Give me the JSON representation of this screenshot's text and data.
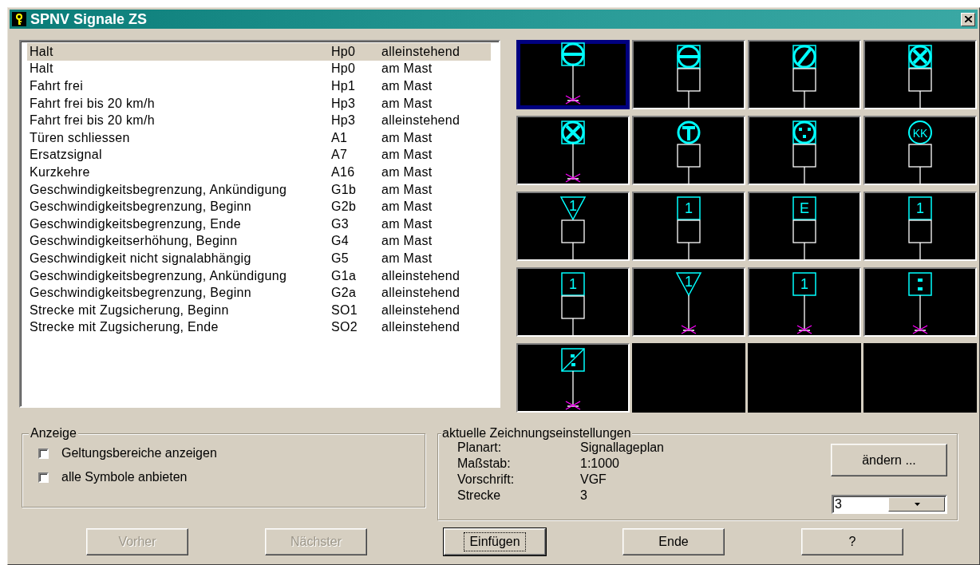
{
  "window": {
    "title": "SPNV Signale ZS"
  },
  "signals": [
    {
      "name": "Halt",
      "code": "Hp0",
      "placement": "alleinstehend",
      "selected": true
    },
    {
      "name": "Halt",
      "code": "Hp0",
      "placement": "am Mast",
      "selected": false
    },
    {
      "name": "Fahrt frei",
      "code": "Hp1",
      "placement": "am Mast",
      "selected": false
    },
    {
      "name": "Fahrt frei bis 20 km/h",
      "code": "Hp3",
      "placement": "am Mast",
      "selected": false
    },
    {
      "name": "Fahrt frei bis 20 km/h",
      "code": "Hp3",
      "placement": "alleinstehend",
      "selected": false
    },
    {
      "name": "Türen schliessen",
      "code": "A1",
      "placement": "am Mast",
      "selected": false
    },
    {
      "name": "Ersatzsignal",
      "code": "A7",
      "placement": "am Mast",
      "selected": false
    },
    {
      "name": "Kurzkehre",
      "code": "A16",
      "placement": "am Mast",
      "selected": false
    },
    {
      "name": "Geschwindigkeitsbegrenzung, Ankündigung",
      "code": "G1b",
      "placement": "am Mast",
      "selected": false
    },
    {
      "name": "Geschwindigkeitsbegrenzung, Beginn",
      "code": "G2b",
      "placement": "am Mast",
      "selected": false
    },
    {
      "name": "Geschwindigkeitsbegrenzung, Ende",
      "code": "G3",
      "placement": "am Mast",
      "selected": false
    },
    {
      "name": "Geschwindigkeitserhöhung, Beginn",
      "code": "G4",
      "placement": "am Mast",
      "selected": false
    },
    {
      "name": "Geschwindigkeit nicht signalabhängig",
      "code": "G5",
      "placement": "am Mast",
      "selected": false
    },
    {
      "name": "Geschwindigkeitsbegrenzung, Ankündigung",
      "code": "G1a",
      "placement": "alleinstehend",
      "selected": false
    },
    {
      "name": "Geschwindigkeitsbegrenzung, Beginn",
      "code": "G2a",
      "placement": "alleinstehend",
      "selected": false
    },
    {
      "name": "Strecke mit Zugsicherung, Beginn",
      "code": "SO1",
      "placement": "alleinstehend",
      "selected": false
    },
    {
      "name": "Strecke mit Zugsicherung, Ende",
      "code": "SO2",
      "placement": "alleinstehend",
      "selected": false
    }
  ],
  "tiles": [
    {
      "kind": "circlebar",
      "mast": false,
      "selected": true
    },
    {
      "kind": "circlebar",
      "mast": true,
      "selected": false
    },
    {
      "kind": "circleslash",
      "mast": true,
      "selected": false
    },
    {
      "kind": "circlecross",
      "mast": true,
      "selected": false
    },
    {
      "kind": "circlecross",
      "mast": false,
      "selected": false
    },
    {
      "kind": "circlet",
      "mast": true,
      "selected": false
    },
    {
      "kind": "circledots",
      "mast": true,
      "selected": false
    },
    {
      "kind": "circleletters",
      "label": "KK",
      "mast": true,
      "selected": false
    },
    {
      "kind": "triangle",
      "label": "1",
      "mast": true,
      "selected": false
    },
    {
      "kind": "box",
      "label": "1",
      "mast": true,
      "selected": false
    },
    {
      "kind": "box",
      "label": "E",
      "mast": true,
      "selected": false
    },
    {
      "kind": "box",
      "label": "1",
      "mast": true,
      "selected": false
    },
    {
      "kind": "box",
      "label": "1",
      "mast": true,
      "selected": false
    },
    {
      "kind": "triangle",
      "label": "1",
      "mast": false,
      "selected": false
    },
    {
      "kind": "box",
      "label": "1",
      "mast": false,
      "selected": false
    },
    {
      "kind": "boxdots",
      "mast": false,
      "selected": false
    },
    {
      "kind": "boxslashdots",
      "mast": false,
      "selected": false
    },
    {
      "kind": "empty"
    },
    {
      "kind": "empty"
    },
    {
      "kind": "empty"
    }
  ],
  "display_group": {
    "title": "Anzeige",
    "options": [
      {
        "label": "Geltungsbereiche anzeigen",
        "checked": false
      },
      {
        "label": "alle Symbole anbieten",
        "checked": false
      }
    ]
  },
  "settings_group": {
    "title": "aktuelle Zeichnungseinstellungen",
    "rows": [
      {
        "label": "Planart:",
        "value": "Signallageplan"
      },
      {
        "label": "Maßstab:",
        "value": "1:1000"
      },
      {
        "label": "Vorschrift:",
        "value": "VGF"
      },
      {
        "label": "Strecke",
        "value": "3"
      }
    ],
    "change_button": "ändern ...",
    "track_combo": {
      "value": "3"
    }
  },
  "buttons": [
    {
      "label": "Vorher",
      "disabled": true,
      "focused": false
    },
    {
      "label": "Nächster",
      "disabled": true,
      "focused": false
    },
    {
      "label": "Einfügen",
      "disabled": false,
      "focused": true
    },
    {
      "label": "Ende",
      "disabled": false,
      "focused": false
    },
    {
      "label": "?",
      "disabled": false,
      "focused": false
    }
  ]
}
